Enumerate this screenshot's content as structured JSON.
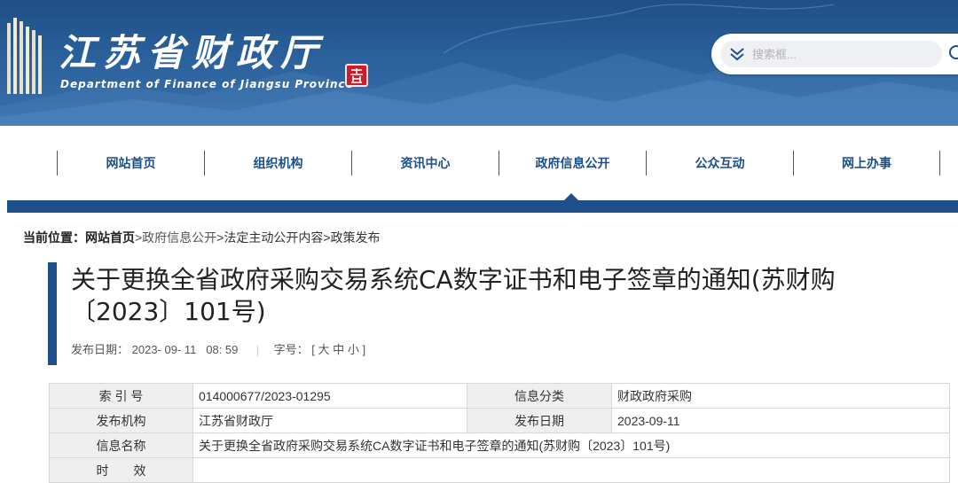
{
  "header": {
    "site_title": "江苏省财政厅",
    "site_subtitle": "Department of Finance of Jiangsu Province",
    "seal_text": "苏"
  },
  "search": {
    "placeholder": "搜索框..."
  },
  "nav": {
    "items": [
      {
        "label": "网站首页"
      },
      {
        "label": "组织机构"
      },
      {
        "label": "资讯中心"
      },
      {
        "label": "政府信息公开"
      },
      {
        "label": "公众互动"
      },
      {
        "label": "网上办事"
      }
    ],
    "active_index": 3
  },
  "breadcrumb": {
    "prefix": "当前位置：",
    "home": "网站首页",
    "c1": ">政府信息公开",
    "c2": ">法定主动公开内容",
    "c3": ">政策发布"
  },
  "article": {
    "title": "关于更换全省政府采购交易系统CA数字证书和电子签章的通知(苏财购〔2023〕101号)",
    "date_label": "发布日期：",
    "date_value": "2023- 09- 11   08: 59",
    "font_label": "字号：",
    "font_open": "[",
    "font_large": "大",
    "font_medium": "中",
    "font_small": "小",
    "font_close": "]"
  },
  "info": {
    "index_label": "索 引 号",
    "index_value": "014000677/2023-01295",
    "category_label": "信息分类",
    "category_value": "财政政府采购",
    "org_label": "发布机构",
    "org_value": "江苏省财政厅",
    "pubdate_label": "发布日期",
    "pubdate_value": "2023-09-11",
    "name_label": "信息名称",
    "name_value": "关于更换全省政府采购交易系统CA数字证书和电子签章的通知(苏财购〔2023〕101号)",
    "validity_label": "时　　效",
    "validity_value": ""
  },
  "colors": {
    "primary": "#1d4f8a",
    "nav_text": "#1b4f88",
    "header_bg": "#2a609b",
    "seal": "#c8202a"
  }
}
